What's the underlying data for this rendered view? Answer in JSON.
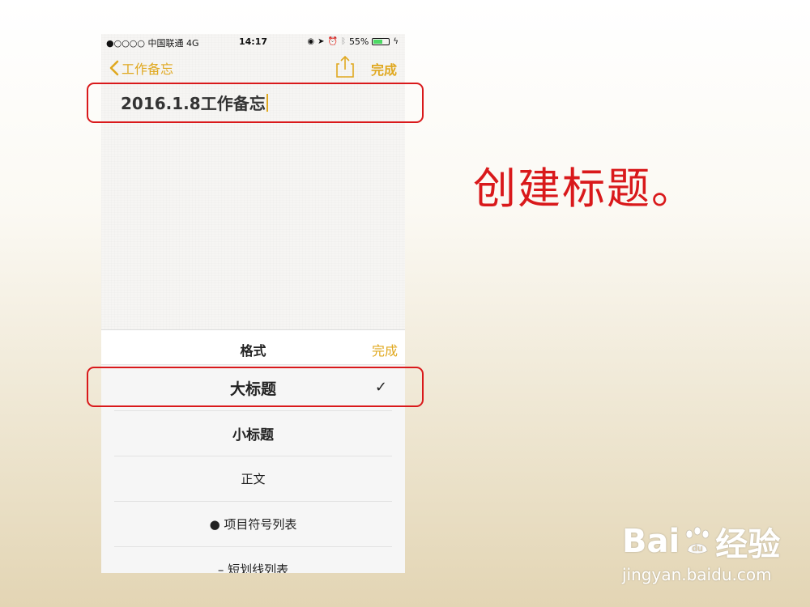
{
  "status_bar": {
    "carrier": "●○○○○ 中国联通  4G",
    "time": "14:17",
    "battery_percent": "55%",
    "battery_level": 0.55
  },
  "navbar": {
    "back_label": "工作备忘",
    "done_label": "完成",
    "accent_color": "#e0a81f"
  },
  "note": {
    "title": "2016.1.8工作备忘"
  },
  "format_sheet": {
    "title": "格式",
    "done_label": "完成",
    "options": [
      {
        "label": "大标题",
        "selected": true
      },
      {
        "label": "小标题",
        "selected": false
      },
      {
        "label": "正文",
        "selected": false
      },
      {
        "label": "● 项目符号列表",
        "selected": false
      },
      {
        "label": "– 短划线列表",
        "selected": false
      }
    ],
    "checkmark": "✓"
  },
  "caption": "创建标题。",
  "annotation_color": "#d9191b",
  "watermark": {
    "logo_text_left": "Bai",
    "logo_text_right": "经验",
    "url": "jingyan.baidu.com"
  }
}
